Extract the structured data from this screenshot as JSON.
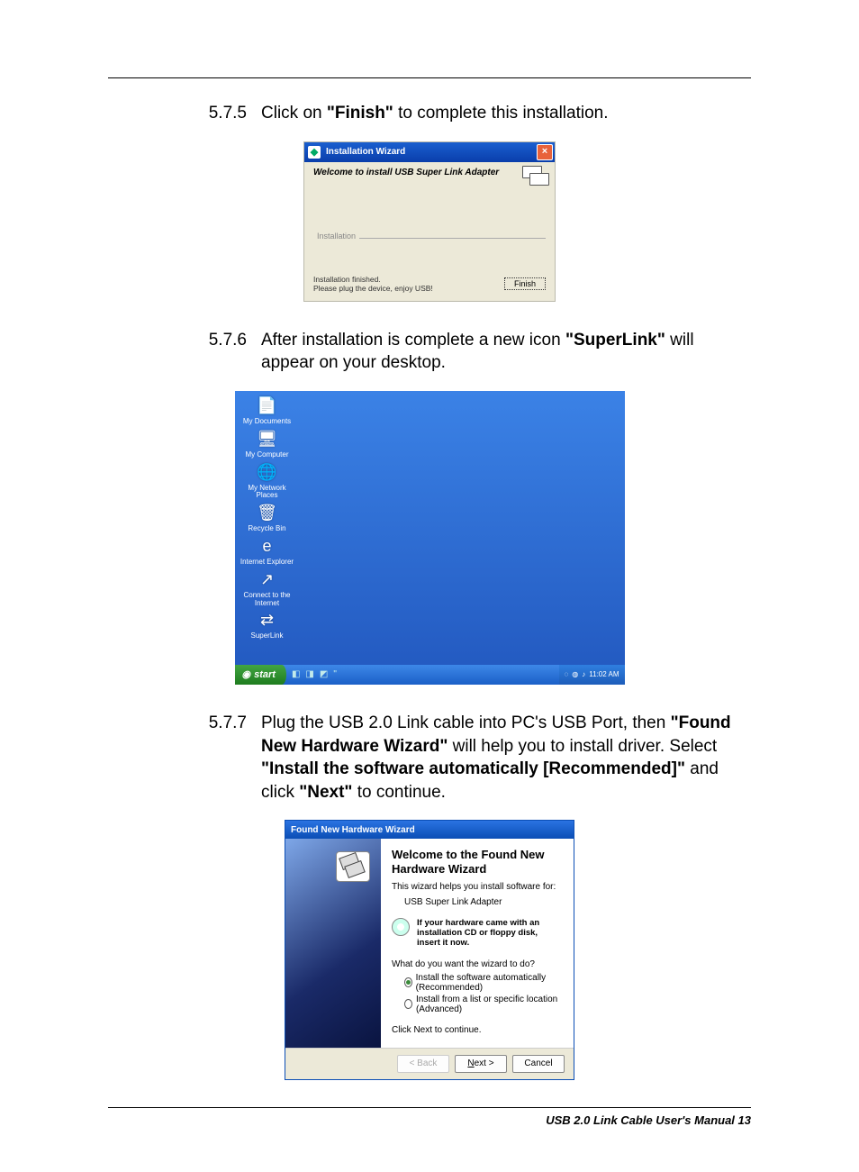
{
  "steps": {
    "s575": {
      "num": "5.7.5",
      "text_pre": "Click on ",
      "bold1": "\"Finish\"",
      "text_post": " to complete this installation."
    },
    "s576": {
      "num": "5.7.6",
      "text_pre": "After installation is complete a new icon ",
      "bold1": "\"SuperLink\"",
      "text_post": " will appear on your desktop."
    },
    "s577": {
      "num": "5.7.7",
      "seg1": "Plug the USB 2.0 Link cable into PC's USB Port, then ",
      "b1": "\"Found New Hardware Wizard\"",
      "seg2": " will help you to install driver. Select ",
      "b2": "\"Install the software automatically [Recommended]\"",
      "seg3": " and click ",
      "b3": "\"Next\"",
      "seg4": " to continue."
    }
  },
  "dlg1": {
    "title": "Installation   Wizard",
    "welcome": "Welcome to install USB Super Link Adapter",
    "legend": "Installation",
    "msg1": "Installation finished.",
    "msg2": "Please plug the device, enjoy USB!",
    "finish": "Finish"
  },
  "desktop": {
    "icons": [
      {
        "label": "My Documents",
        "glyph": "📄"
      },
      {
        "label": "My Computer",
        "glyph": "🖥"
      },
      {
        "label": "My Network Places",
        "glyph": "🌐"
      },
      {
        "label": "Recycle Bin",
        "glyph": "🗑"
      },
      {
        "label": "Internet Explorer",
        "glyph": "e"
      },
      {
        "label": "Connect to the Internet",
        "glyph": "↗"
      },
      {
        "label": "SuperLink",
        "glyph": "⇄"
      }
    ],
    "start": "start",
    "clock": "11:02 AM"
  },
  "dlg2": {
    "title": "Found New Hardware Wizard",
    "heading": "Welcome to the Found New Hardware Wizard",
    "intro": "This wizard helps you install software for:",
    "device": "USB Super Link Adapter",
    "cd_hint": "If your hardware came with an installation CD or floppy disk, insert it now.",
    "what": "What do you want the wizard to do?",
    "opt1": "Install the software automatically (Recommended)",
    "opt2": "Install from a list or specific location (Advanced)",
    "next_hint": "Click Next to continue.",
    "back": "< Back",
    "next": "Next >",
    "cancel": "Cancel"
  },
  "footer": "USB 2.0 Link Cable User's Manual 13"
}
